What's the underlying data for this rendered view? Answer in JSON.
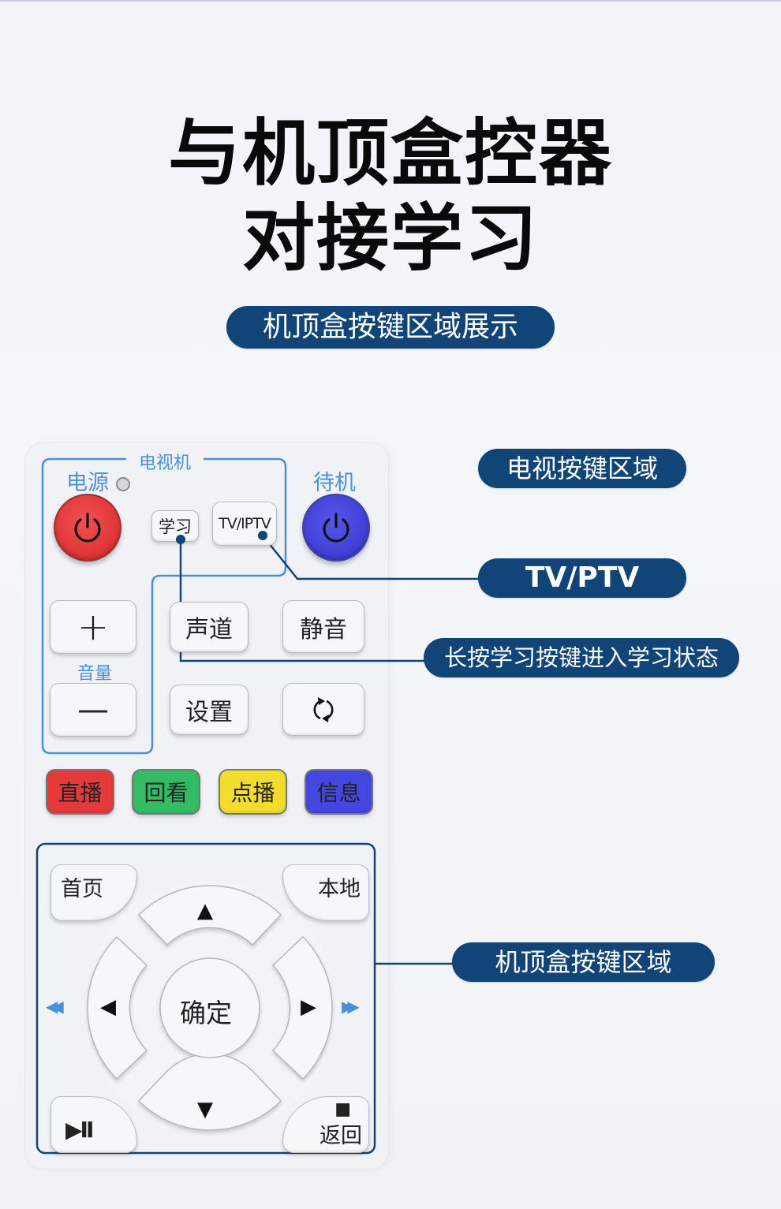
{
  "heading": {
    "line1": "与机顶盒控器",
    "line2": "对接学习",
    "subtitle": "机顶盒按键区域展示"
  },
  "colors": {
    "accent_navy": "#114477",
    "label_blue": "#4a90d9",
    "power_red": "#e5393b",
    "standby_blue": "#4444dd",
    "live_red": "#e53a3c",
    "replay_green": "#33bb66",
    "vod_yellow": "#f2dc2e",
    "info_blue": "#4347df"
  },
  "remote": {
    "tv_group_label": "电视机",
    "power_label": "电源",
    "standby_label": "待机",
    "learn_button": "学习",
    "tv_iptv_button": "TV/IPTV",
    "volume_label": "音量",
    "vol_up": "+",
    "vol_down": "—",
    "audio_track": "声道",
    "mute": "静音",
    "settings": "设置",
    "switch_icon": "⟳",
    "color_buttons": [
      {
        "label": "直播",
        "color": "#e53a3c"
      },
      {
        "label": "回看",
        "color": "#33bb66"
      },
      {
        "label": "点播",
        "color": "#f2dc2e"
      },
      {
        "label": "信息",
        "color": "#4347df"
      }
    ],
    "home": "首页",
    "local": "本地",
    "ok": "确定",
    "up": "▲",
    "down": "▼",
    "left": "◀",
    "right": "▶",
    "rewind": "◀◀",
    "fast_forward": "▶▶",
    "play_pause": "▶II",
    "stop_symbol": "■",
    "back": "返回"
  },
  "callouts": {
    "tv_area": "电视按键区域",
    "tv_ptv": "TV/PTV",
    "learn_hint": "长按学习按键进入学习状态",
    "stb_area": "机顶盒按键区域"
  }
}
